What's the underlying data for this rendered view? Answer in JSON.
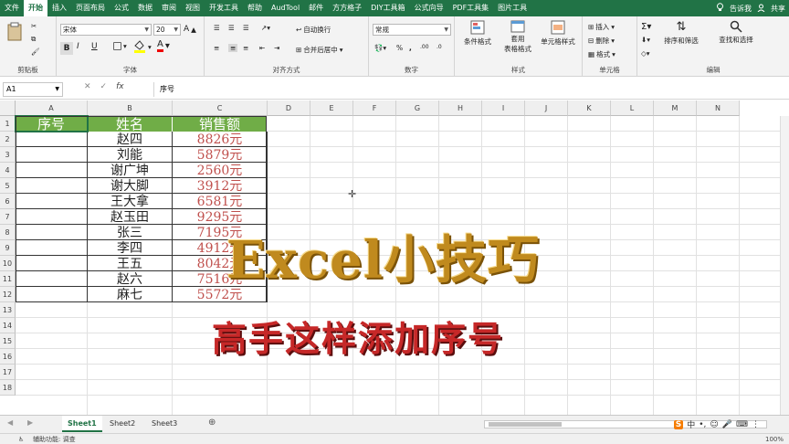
{
  "tabs": [
    "文件",
    "开始",
    "插入",
    "页面布局",
    "公式",
    "数据",
    "审阅",
    "视图",
    "开发工具",
    "帮助",
    "AudTool",
    "邮件",
    "方方格子",
    "DIY工具箱",
    "公式向导",
    "PDF工具集",
    "图片工具"
  ],
  "tell_me": "告诉我",
  "share": "共享",
  "ribbon": {
    "font_name": "宋体",
    "font_size": "20",
    "wrap_text": "自动换行",
    "merge_center": "合并后居中",
    "number_format": "常规",
    "conditional_format": "条件格式",
    "table_format_line1": "套用",
    "table_format_line2": "表格格式",
    "cell_style": "单元格样式",
    "insert": "插入",
    "delete": "删除",
    "format": "格式",
    "sort_filter": "排序和筛选",
    "find_select": "查找和选择",
    "groups": [
      "剪贴板",
      "字体",
      "对齐方式",
      "数字",
      "样式",
      "单元格",
      "编辑"
    ],
    "bold": "B",
    "italic": "I",
    "underline": "U"
  },
  "formula_bar": {
    "name_box": "A1",
    "formula": "序号"
  },
  "columns": [
    "A",
    "B",
    "C",
    "D",
    "E",
    "F",
    "G",
    "H",
    "I",
    "J",
    "K",
    "L",
    "M",
    "N"
  ],
  "rows": [
    "1",
    "2",
    "3",
    "4",
    "5",
    "6",
    "7",
    "8",
    "9",
    "10",
    "11",
    "12",
    "13",
    "14",
    "15",
    "16",
    "17",
    "18"
  ],
  "table": {
    "headers": [
      "序号",
      "姓名",
      "销售额"
    ],
    "rows": [
      [
        "",
        "赵四",
        "8826元"
      ],
      [
        "",
        "刘能",
        "5879元"
      ],
      [
        "",
        "谢广坤",
        "2560元"
      ],
      [
        "",
        "谢大脚",
        "3912元"
      ],
      [
        "",
        "王大拿",
        "6581元"
      ],
      [
        "",
        "赵玉田",
        "9295元"
      ],
      [
        "",
        "张三",
        "7195元"
      ],
      [
        "",
        "李四",
        "4912元"
      ],
      [
        "",
        "王五",
        "8042元"
      ],
      [
        "",
        "赵六",
        "7516元"
      ],
      [
        "",
        "麻七",
        "5572元"
      ]
    ]
  },
  "overlay": {
    "title": "Excel小技巧",
    "subtitle": "高手这样添加序号"
  },
  "sheets": [
    "Sheet1",
    "Sheet2",
    "Sheet3"
  ],
  "status": "辅助功能: 调查",
  "ime": {
    "logo": "S",
    "lang": "中",
    "zoom": "100%"
  },
  "colors": {
    "excel_green": "#217346",
    "header_fill": "#70ad47",
    "value_red": "#c0504d",
    "title_gold": "#c08a1e",
    "subtitle_red": "#c62828"
  }
}
